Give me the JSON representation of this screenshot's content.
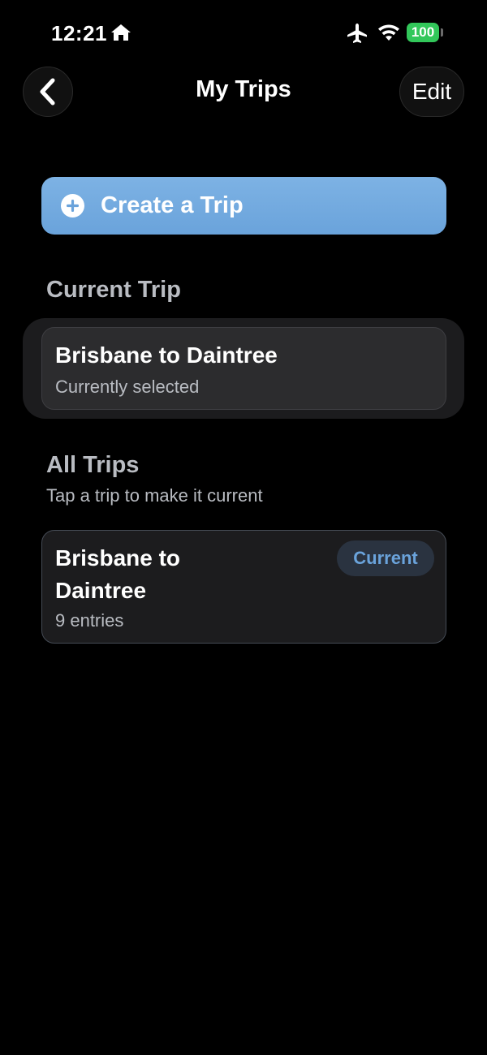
{
  "status_bar": {
    "time": "12:21",
    "battery": "100",
    "icons": [
      "home-icon",
      "airplane-icon",
      "wifi-icon",
      "battery-icon"
    ]
  },
  "nav": {
    "title": "My Trips",
    "edit_label": "Edit",
    "back_icon": "chevron-left-icon"
  },
  "create_button": {
    "label": "Create a Trip",
    "icon": "plus-circle-icon"
  },
  "current_trip": {
    "heading": "Current Trip",
    "name": "Brisbane to Daintree",
    "status": "Currently selected"
  },
  "all_trips": {
    "heading": "All Trips",
    "subtitle": "Tap a trip to make it current",
    "items": [
      {
        "name": "Brisbane to Daintree",
        "entries": "9 entries",
        "badge": "Current"
      }
    ]
  },
  "colors": {
    "background": "#000000",
    "accent": "#6aa3db",
    "battery": "#32c75a",
    "card": "#1c1c1e",
    "secondary_text": "#b9bcc2"
  }
}
